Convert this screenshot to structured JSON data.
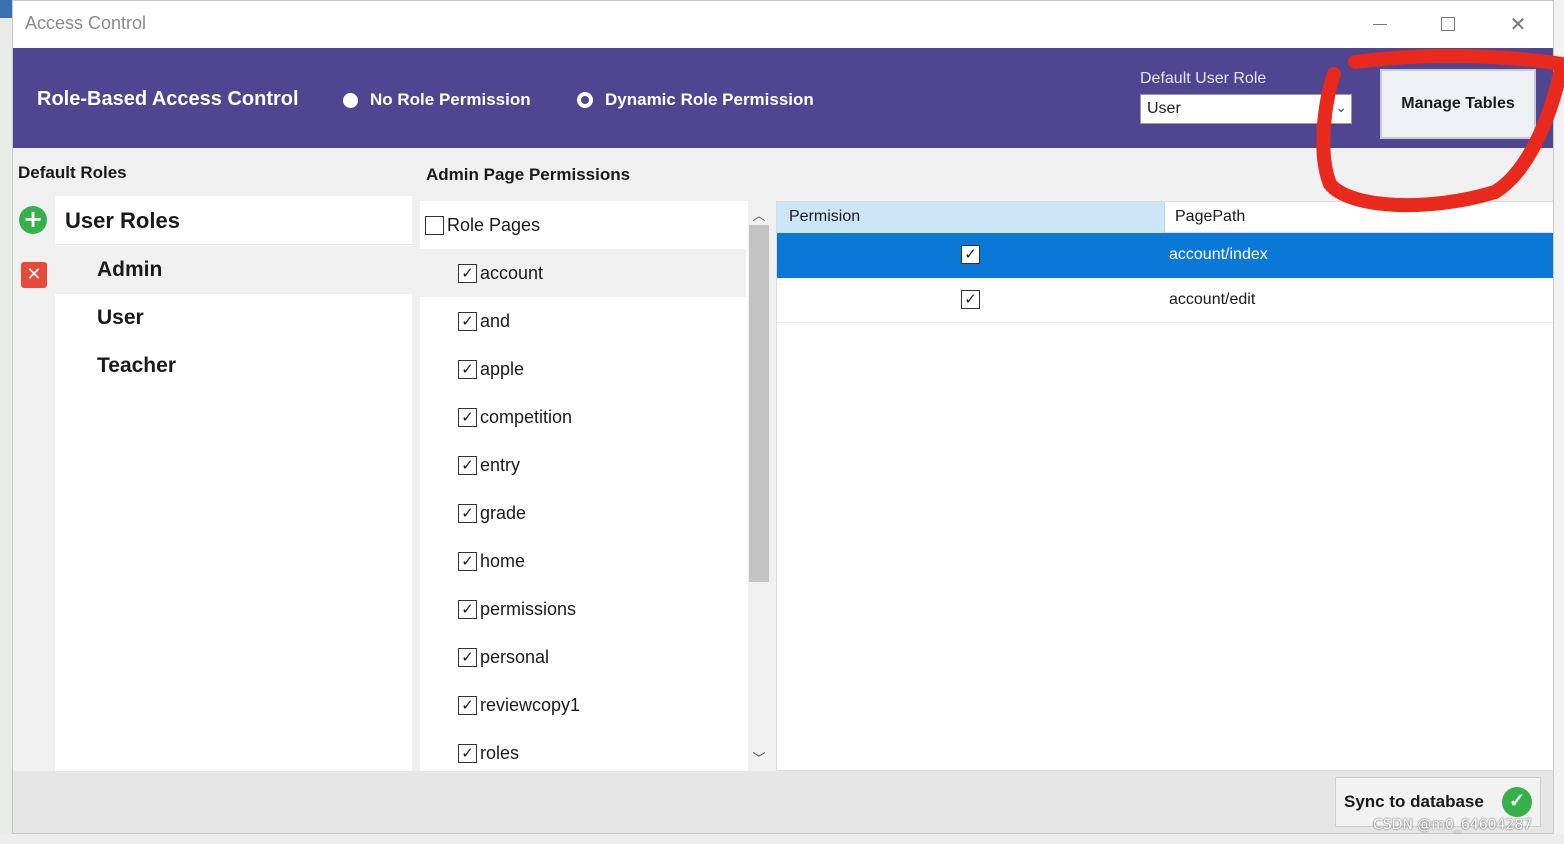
{
  "window": {
    "title": "Access Control",
    "controls": {
      "minimize": "minimize-icon",
      "maximize": "maximize-icon",
      "close": "close-icon"
    }
  },
  "header": {
    "heading": "Role-Based Access Control",
    "radio_no_role": "No Role Permission",
    "radio_dynamic": "Dynamic Role Permission",
    "default_role_label": "Default User Role",
    "default_role_value": "User",
    "manage_tables": "Manage Tables",
    "bg_color": "#4f4590"
  },
  "left": {
    "section_label": "Default Roles",
    "roles_header": "User Roles",
    "roles": [
      "Admin",
      "User",
      "Teacher"
    ],
    "selected_role": "Admin"
  },
  "pages": {
    "section_label": "Admin Page Permissions",
    "header_label": "Role Pages",
    "header_checked": false,
    "items": [
      "account",
      "and",
      "apple",
      "competition",
      "entry",
      "grade",
      "home",
      "permissions",
      "personal",
      "reviewcopy1",
      "roles"
    ],
    "all_checked": true,
    "selected": "account"
  },
  "grid": {
    "col_permission": "Permision",
    "col_pagepath": "PagePath",
    "rows": [
      {
        "checked": true,
        "path": "account/index",
        "selected": true
      },
      {
        "checked": true,
        "path": "account/edit",
        "selected": false
      }
    ],
    "selection_color": "#0a78d7"
  },
  "footer": {
    "sync_label": "Sync to database"
  },
  "watermark": "CSDN @m0_64604287",
  "colors": {
    "add": "#35b04a",
    "delete": "#e64a3b",
    "annotation": "#e8291c"
  }
}
